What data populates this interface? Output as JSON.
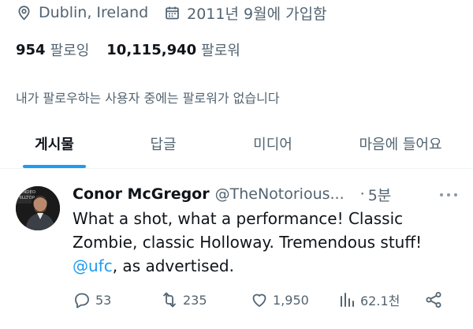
{
  "profile": {
    "location": "Dublin, Ireland",
    "joined": "2011년 9월에 가입함",
    "following_count": "954",
    "following_label": "팔로잉",
    "followers_count": "10,115,940",
    "followers_label": "팔로워",
    "notice": "내가 팔로우하는 사용자 중에는 팔로워가 없습니다"
  },
  "tabs": [
    {
      "label": "게시물",
      "active": true
    },
    {
      "label": "답글",
      "active": false
    },
    {
      "label": "미디어",
      "active": false
    },
    {
      "label": "마음에 들어요",
      "active": false
    }
  ],
  "tweet": {
    "author_name": "Conor McGregor",
    "handle": "@TheNotorious...",
    "dot": "·",
    "time": "5분",
    "body_line1": "What a shot, what a performance! Classic",
    "body_line2": "Zombie, classic Holloway. Tremendous stuff!",
    "mention": "@ufc",
    "body_line3_rest": ", as advertised.",
    "replies": "53",
    "reposts": "235",
    "likes": "1,950",
    "views": "62.1천"
  },
  "colors": {
    "accent": "#1d9bf0",
    "text": "#0f1419",
    "muted": "#536471",
    "border": "#eff3f4"
  },
  "icons": [
    "location-icon",
    "calendar-icon",
    "more-icon",
    "reply-icon",
    "repost-icon",
    "like-icon",
    "views-icon",
    "share-icon"
  ]
}
